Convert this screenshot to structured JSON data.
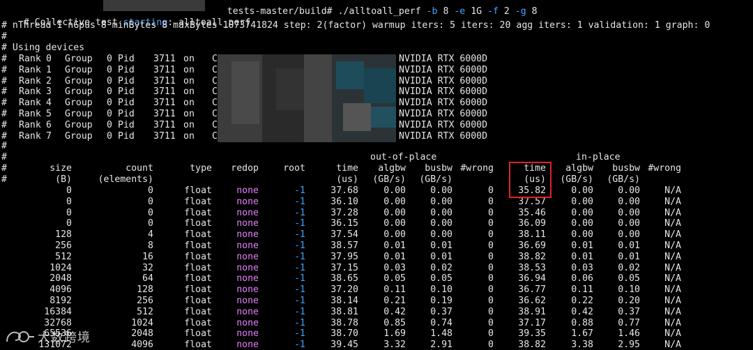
{
  "colors": {
    "background": "#000000",
    "text": "#e6e6e6",
    "flag": "#4aa3ff",
    "redop_value": "#e67fff",
    "root_value": "#3ea6ff",
    "highlight_box": "#e0232a"
  },
  "header": {
    "line0_prefix": "# Collective test ",
    "line0_highlight": "starting",
    "line0_suffix": ": alltoall_perf",
    "prompt_path": "tests-master/build# ",
    "command": {
      "program": "./alltoall_perf",
      "args": [
        {
          "flag": "-b",
          "value": "8"
        },
        {
          "flag": "-e",
          "value": "1G"
        },
        {
          "flag": "-f",
          "value": "2"
        },
        {
          "flag": "-g",
          "value": "8"
        }
      ]
    },
    "line1": "# nThread 1 nGpus 8 minBytes 8 maxBytes 1073741824 step: 2(factor) warmup iters: 5 iters: 20 agg iters: 1 validation: 1 graph: 0",
    "line2": "#",
    "line3": "# Using devices"
  },
  "devices": [
    {
      "rank": "0",
      "group": "0",
      "pid": "3711",
      "on": "on",
      "host": "C",
      "gpu": "NVIDIA RTX 6000D"
    },
    {
      "rank": "1",
      "group": "0",
      "pid": "3711",
      "on": "on",
      "host": "C",
      "gpu": "NVIDIA RTX 6000D"
    },
    {
      "rank": "2",
      "group": "0",
      "pid": "3711",
      "on": "on",
      "host": "C",
      "gpu": "NVIDIA RTX 6000D"
    },
    {
      "rank": "3",
      "group": "0",
      "pid": "3711",
      "on": "on",
      "host": "C",
      "gpu": "NVIDIA RTX 6000D"
    },
    {
      "rank": "4",
      "group": "0",
      "pid": "3711",
      "on": "on",
      "host": "C",
      "gpu": "NVIDIA RTX 6000D"
    },
    {
      "rank": "5",
      "group": "0",
      "pid": "3711",
      "on": "on",
      "host": "C",
      "gpu": "NVIDIA RTX 6000D"
    },
    {
      "rank": "6",
      "group": "0",
      "pid": "3711",
      "on": "on",
      "host": "C",
      "gpu": "NVIDIA RTX 6000D"
    },
    {
      "rank": "7",
      "group": "0",
      "pid": "3711",
      "on": "on",
      "host": "C",
      "gpu": "NVIDIA RTX 6000D"
    }
  ],
  "device_labels": {
    "hash": "#",
    "rank": "Rank",
    "group": "Group",
    "pid": "Pid"
  },
  "spacer_line": "#",
  "table": {
    "group_headers": {
      "out_of_place": "out-of-place",
      "in_place": "in-place"
    },
    "columns": [
      {
        "key": "size",
        "label": "size",
        "unit": "(B)"
      },
      {
        "key": "count",
        "label": "count",
        "unit": "(elements)"
      },
      {
        "key": "type",
        "label": "type",
        "unit": ""
      },
      {
        "key": "redop",
        "label": "redop",
        "unit": ""
      },
      {
        "key": "root",
        "label": "root",
        "unit": ""
      },
      {
        "key": "oop_time",
        "label": "time",
        "unit": "(us)"
      },
      {
        "key": "oop_algbw",
        "label": "algbw",
        "unit": "(GB/s)"
      },
      {
        "key": "oop_busbw",
        "label": "busbw",
        "unit": "(GB/s)"
      },
      {
        "key": "oop_wrong",
        "label": "#wrong",
        "unit": ""
      },
      {
        "key": "ip_time",
        "label": "time",
        "unit": "(us)"
      },
      {
        "key": "ip_algbw",
        "label": "algbw",
        "unit": "(GB/s)"
      },
      {
        "key": "ip_busbw",
        "label": "busbw",
        "unit": "(GB/s)"
      },
      {
        "key": "ip_wrong",
        "label": "#wrong",
        "unit": ""
      }
    ],
    "rows": [
      [
        "0",
        "0",
        "float",
        "none",
        "-1",
        "37.68",
        "0.00",
        "0.00",
        "0",
        "35.82",
        "0.00",
        "0.00",
        "N/A"
      ],
      [
        "0",
        "0",
        "float",
        "none",
        "-1",
        "36.10",
        "0.00",
        "0.00",
        "0",
        "37.57",
        "0.00",
        "0.00",
        "N/A"
      ],
      [
        "0",
        "0",
        "float",
        "none",
        "-1",
        "37.28",
        "0.00",
        "0.00",
        "0",
        "35.46",
        "0.00",
        "0.00",
        "N/A"
      ],
      [
        "0",
        "0",
        "float",
        "none",
        "-1",
        "36.15",
        "0.00",
        "0.00",
        "0",
        "36.09",
        "0.00",
        "0.00",
        "N/A"
      ],
      [
        "128",
        "4",
        "float",
        "none",
        "-1",
        "37.54",
        "0.00",
        "0.00",
        "0",
        "38.11",
        "0.00",
        "0.00",
        "N/A"
      ],
      [
        "256",
        "8",
        "float",
        "none",
        "-1",
        "38.57",
        "0.01",
        "0.01",
        "0",
        "36.69",
        "0.01",
        "0.01",
        "N/A"
      ],
      [
        "512",
        "16",
        "float",
        "none",
        "-1",
        "37.95",
        "0.01",
        "0.01",
        "0",
        "38.82",
        "0.01",
        "0.01",
        "N/A"
      ],
      [
        "1024",
        "32",
        "float",
        "none",
        "-1",
        "37.15",
        "0.03",
        "0.02",
        "0",
        "38.53",
        "0.03",
        "0.02",
        "N/A"
      ],
      [
        "2048",
        "64",
        "float",
        "none",
        "-1",
        "38.65",
        "0.05",
        "0.05",
        "0",
        "36.94",
        "0.06",
        "0.05",
        "N/A"
      ],
      [
        "4096",
        "128",
        "float",
        "none",
        "-1",
        "37.20",
        "0.11",
        "0.10",
        "0",
        "36.77",
        "0.11",
        "0.10",
        "N/A"
      ],
      [
        "8192",
        "256",
        "float",
        "none",
        "-1",
        "38.14",
        "0.21",
        "0.19",
        "0",
        "36.62",
        "0.22",
        "0.20",
        "N/A"
      ],
      [
        "16384",
        "512",
        "float",
        "none",
        "-1",
        "38.81",
        "0.42",
        "0.37",
        "0",
        "38.91",
        "0.42",
        "0.37",
        "N/A"
      ],
      [
        "32768",
        "1024",
        "float",
        "none",
        "-1",
        "38.78",
        "0.85",
        "0.74",
        "0",
        "37.17",
        "0.88",
        "0.77",
        "N/A"
      ],
      [
        "65536",
        "2048",
        "float",
        "none",
        "-1",
        "38.70",
        "1.69",
        "1.48",
        "0",
        "39.35",
        "1.67",
        "1.46",
        "N/A"
      ],
      [
        "131072",
        "4096",
        "float",
        "none",
        "-1",
        "39.45",
        "3.32",
        "2.91",
        "0",
        "38.82",
        "3.38",
        "2.95",
        "N/A"
      ]
    ]
  },
  "watermark": {
    "text": "大数跨境",
    "icon": "watermark-logo-icon"
  }
}
